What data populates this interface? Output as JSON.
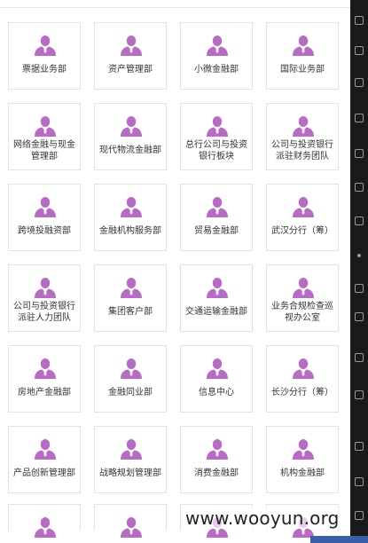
{
  "departments": [
    {
      "label": "票据业务部"
    },
    {
      "label": "资产管理部"
    },
    {
      "label": "小微金融部"
    },
    {
      "label": "国际业务部"
    },
    {
      "label": "网络金融与现金管理部"
    },
    {
      "label": "现代物流金融部"
    },
    {
      "label": "总行公司与投资银行板块"
    },
    {
      "label": "公司与投资银行派驻财务团队"
    },
    {
      "label": "跨境投融资部"
    },
    {
      "label": "金融机构服务部"
    },
    {
      "label": "贸易金融部"
    },
    {
      "label": "武汉分行（筹）"
    },
    {
      "label": "公司与投资银行派驻人力团队"
    },
    {
      "label": "集团客户部"
    },
    {
      "label": "交通运输金融部"
    },
    {
      "label": "业务合规检查巡视办公室"
    },
    {
      "label": "房地产金融部"
    },
    {
      "label": "金融同业部"
    },
    {
      "label": "信息中心"
    },
    {
      "label": "长沙分行（筹）"
    },
    {
      "label": "产品创新管理部"
    },
    {
      "label": "战略规划管理部"
    },
    {
      "label": "消费金融部"
    },
    {
      "label": "机构金融部"
    }
  ],
  "avatar_icon": "person-avatar-icon",
  "avatar_color": "#b86bc4",
  "watermark": "www.wooyun.org"
}
